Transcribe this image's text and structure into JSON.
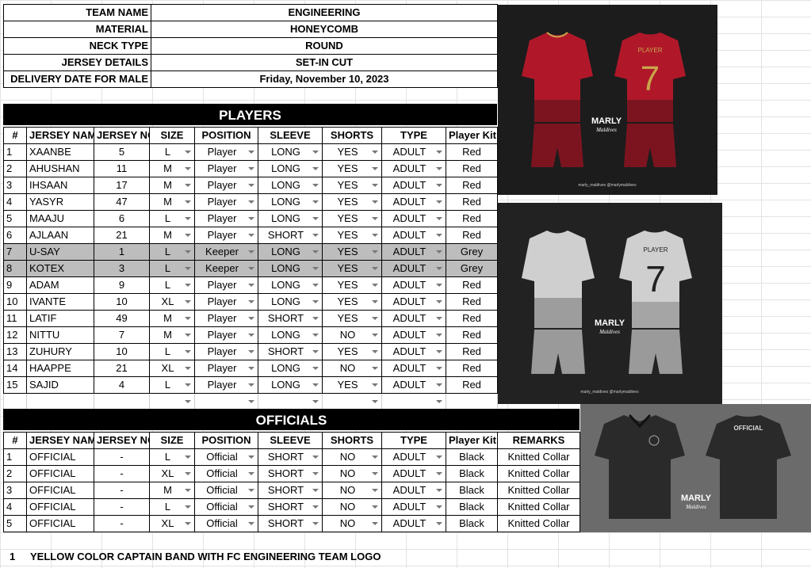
{
  "info": [
    {
      "label": "TEAM NAME",
      "value": "ENGINEERING"
    },
    {
      "label": "MATERIAL",
      "value": "HONEYCOMB"
    },
    {
      "label": "NECK TYPE",
      "value": "ROUND"
    },
    {
      "label": "JERSEY DETAILS",
      "value": "SET-IN CUT"
    },
    {
      "label": "DELIVERY DATE FOR MALE",
      "value": "Friday, November 10, 2023"
    }
  ],
  "players": {
    "title": "PLAYERS",
    "headers": [
      "#",
      "JERSEY NAME",
      "JERSEY NO",
      "SIZE",
      "POSITION",
      "SLEEVE",
      "SHORTS",
      "TYPE",
      "Player Kit"
    ],
    "rows": [
      [
        "1",
        "XAANBE",
        "5",
        "L",
        "Player",
        "LONG",
        "YES",
        "ADULT",
        "Red"
      ],
      [
        "2",
        "AHUSHAN",
        "11",
        "M",
        "Player",
        "LONG",
        "YES",
        "ADULT",
        "Red"
      ],
      [
        "3",
        "IHSAAN",
        "17",
        "M",
        "Player",
        "LONG",
        "YES",
        "ADULT",
        "Red"
      ],
      [
        "4",
        "YASYR",
        "47",
        "M",
        "Player",
        "LONG",
        "YES",
        "ADULT",
        "Red"
      ],
      [
        "5",
        "MAAJU",
        "6",
        "L",
        "Player",
        "LONG",
        "YES",
        "ADULT",
        "Red"
      ],
      [
        "6",
        "AJLAAN",
        "21",
        "M",
        "Player",
        "SHORT",
        "YES",
        "ADULT",
        "Red"
      ],
      [
        "7",
        "U-SAY",
        "1",
        "L",
        "Keeper",
        "LONG",
        "YES",
        "ADULT",
        "Grey"
      ],
      [
        "8",
        "KOTEX",
        "3",
        "L",
        "Keeper",
        "LONG",
        "YES",
        "ADULT",
        "Grey"
      ],
      [
        "9",
        "ADAM",
        "9",
        "L",
        "Player",
        "LONG",
        "YES",
        "ADULT",
        "Red"
      ],
      [
        "10",
        "IVANTE",
        "10",
        "XL",
        "Player",
        "LONG",
        "YES",
        "ADULT",
        "Red"
      ],
      [
        "11",
        "LATIF",
        "49",
        "M",
        "Player",
        "SHORT",
        "YES",
        "ADULT",
        "Red"
      ],
      [
        "12",
        "NITTU",
        "7",
        "M",
        "Player",
        "LONG",
        "NO",
        "ADULT",
        "Red"
      ],
      [
        "13",
        "ZUHURY",
        "10",
        "L",
        "Player",
        "SHORT",
        "YES",
        "ADULT",
        "Red"
      ],
      [
        "14",
        "HAAPPE",
        "21",
        "XL",
        "Player",
        "LONG",
        "NO",
        "ADULT",
        "Red"
      ],
      [
        "15",
        "SAJID",
        "4",
        "L",
        "Player",
        "LONG",
        "YES",
        "ADULT",
        "Red"
      ]
    ]
  },
  "officials": {
    "title": "OFFICIALS",
    "headers": [
      "#",
      "JERSEY NAME",
      "JERSEY NO",
      "SIZE",
      "POSITION",
      "SLEEVE",
      "SHORTS",
      "TYPE",
      "Player Kit",
      "REMARKS"
    ],
    "rows": [
      [
        "1",
        "OFFICIAL",
        "-",
        "L",
        "Official",
        "SHORT",
        "NO",
        "ADULT",
        "Black",
        "Knitted Collar"
      ],
      [
        "2",
        "OFFICIAL",
        "-",
        "XL",
        "Official",
        "SHORT",
        "NO",
        "ADULT",
        "Black",
        "Knitted Collar"
      ],
      [
        "3",
        "OFFICIAL",
        "-",
        "M",
        "Official",
        "SHORT",
        "NO",
        "ADULT",
        "Black",
        "Knitted Collar"
      ],
      [
        "4",
        "OFFICIAL",
        "-",
        "L",
        "Official",
        "SHORT",
        "NO",
        "ADULT",
        "Black",
        "Knitted Collar"
      ],
      [
        "5",
        "OFFICIAL",
        "-",
        "XL",
        "Official",
        "SHORT",
        "NO",
        "ADULT",
        "Black",
        "Knitted Collar"
      ]
    ]
  },
  "footer": {
    "num": "1",
    "text": "YELLOW COLOR CAPTAIN BAND WITH FC ENGINEERING TEAM LOGO"
  },
  "images": {
    "red_kit": {
      "back_text": "PLAYER",
      "number": "7",
      "brand": "MARLY",
      "brand_sub": "Maldives",
      "social": "marly_maldives   @marlymaldives",
      "color": "#b0182a"
    },
    "grey_kit": {
      "back_text": "PLAYER",
      "number": "7",
      "brand": "MARLY",
      "brand_sub": "Maldives",
      "social": "marly_maldives   @marlymaldives",
      "color": "#cfcfcf"
    },
    "black_kit": {
      "back_text": "OFFICIAL",
      "brand": "MARLY",
      "brand_sub": "Maldives",
      "color": "#2a2a2a"
    }
  },
  "colors": {
    "keeper_row": "#bdbdbd",
    "section_bg": "#000000"
  }
}
